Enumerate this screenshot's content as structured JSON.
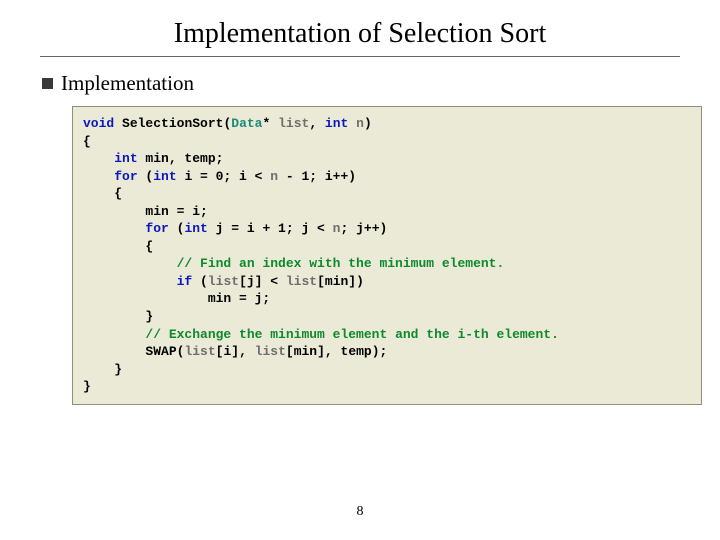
{
  "title": "Implementation of Selection Sort",
  "bullet": "Implementation",
  "page_number": "8",
  "code": {
    "kw_void": "void",
    "fn_name": "SelectionSort",
    "ty_data": "Data",
    "star_list": "* ",
    "var_list": "list",
    "comma_sp": ", ",
    "kw_int": "int",
    "sp": " ",
    "var_n": "n",
    "paren_close": ")",
    "brace_open": "{",
    "decl_min_temp": " min, temp;",
    "kw_for": "for",
    "outer_for_open": " (",
    "outer_i_decl": " i = 0; i < ",
    "outer_after_n": " - 1; i++)",
    "min_eq_i": "min = i;",
    "inner_for_open": " (",
    "inner_j_decl": " j = i + 1; j < ",
    "inner_after_n": "; j++)",
    "comment_find": "// Find an index with the minimum element.",
    "kw_if": "if",
    "if_open": " (",
    "if_mid": "[j] < ",
    "if_close": "[min])",
    "min_eq_j": "min = j;",
    "brace_close": "}",
    "comment_swap": "// Exchange the minimum element and the i-th element.",
    "swap_fn": "SWAP",
    "swap_open": "(",
    "swap_mid1": "[i], ",
    "swap_mid2": "[min], temp);"
  }
}
